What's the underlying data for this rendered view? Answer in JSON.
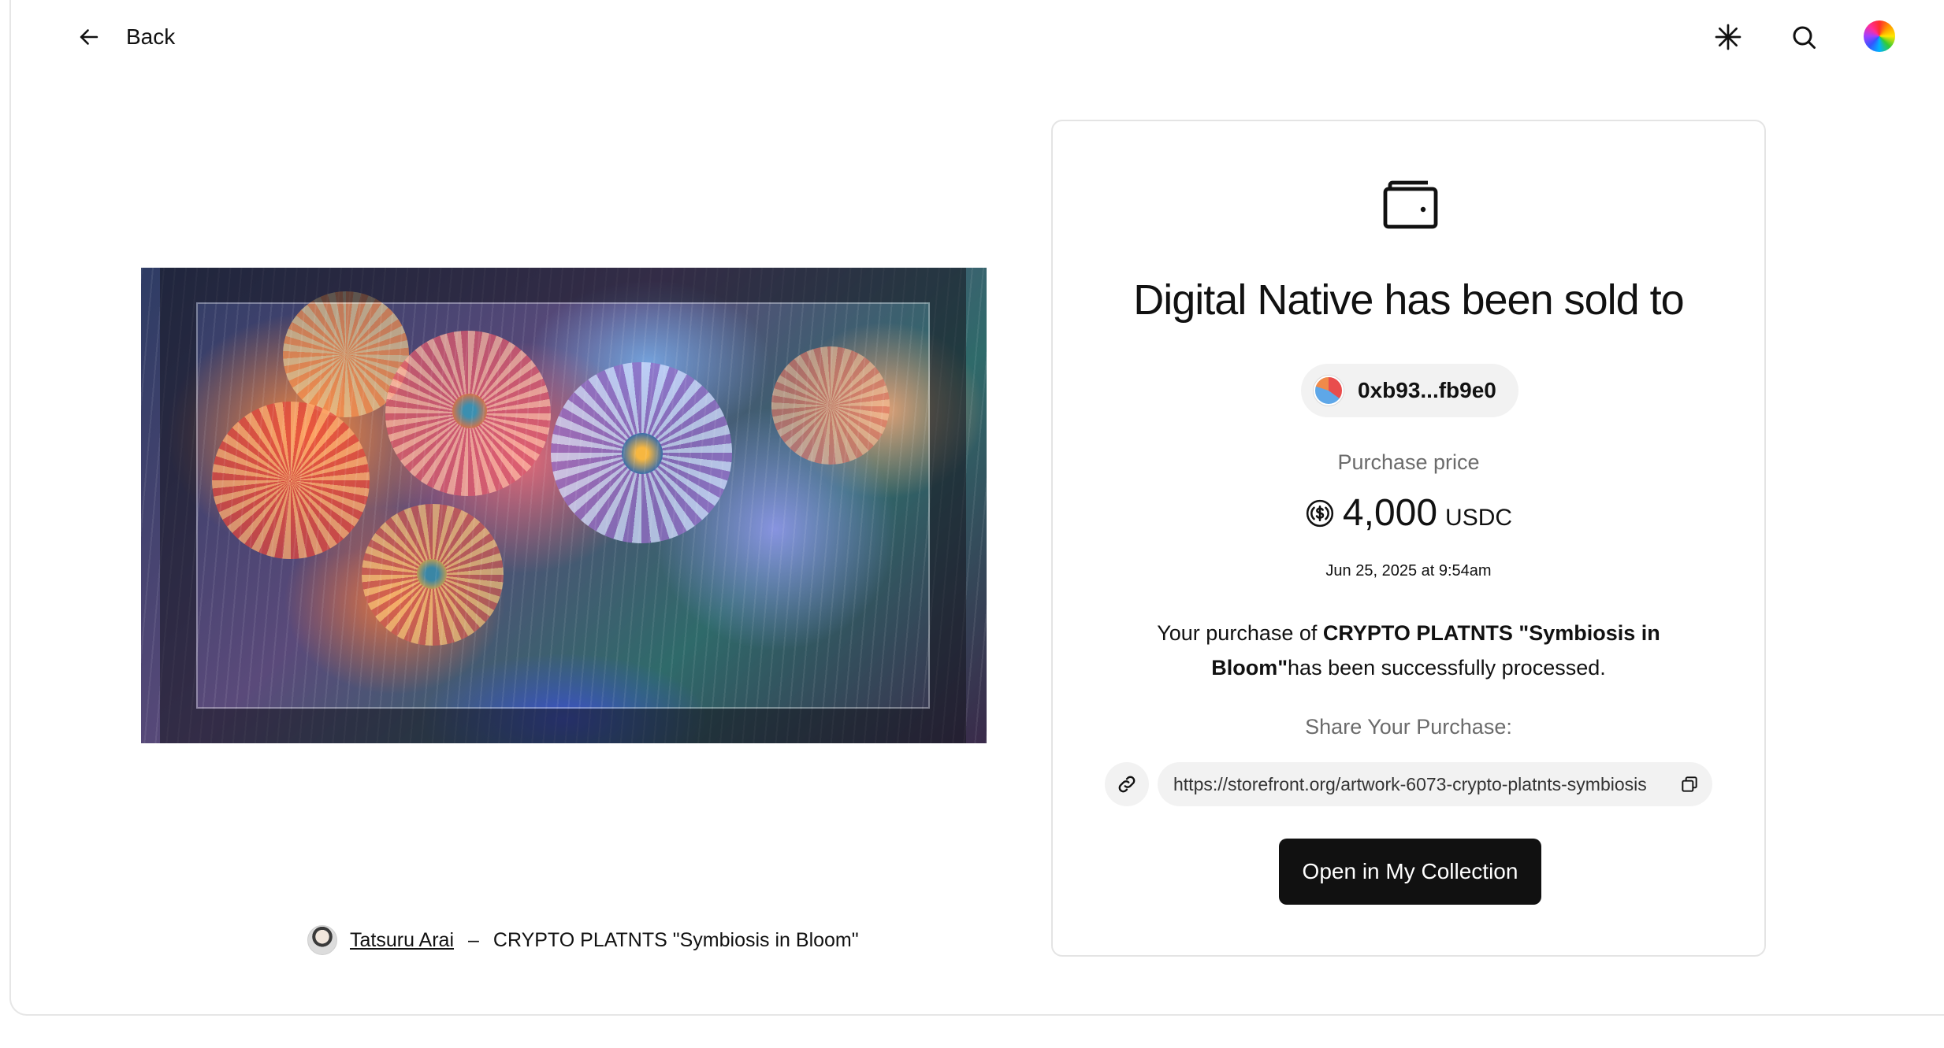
{
  "header": {
    "back_label": "Back",
    "icons": [
      "arrow-left-icon",
      "sparkle-icon",
      "search-icon",
      "profile-avatar"
    ]
  },
  "artwork": {
    "artist": "Tatsuru Arai",
    "separator": "–",
    "title": "CRYPTO PLATNTS \"Symbiosis in Bloom\""
  },
  "sale": {
    "icon": "wallet-icon",
    "heading": "Digital Native has been sold to",
    "buyer_address": "0xb93...fb9e0",
    "price_label": "Purchase price",
    "price_amount": "4,000",
    "price_unit": "USDC",
    "date": "Jun 25, 2025 at 9:54am",
    "message_prefix": "Your purchase of ",
    "message_item": "CRYPTO PLATNTS \"Symbiosis in Bloom\"",
    "message_suffix": "has been successfully processed.",
    "share_label": "Share Your Purchase:",
    "share_url": "https://storefront.org/artwork-6073-crypto-platnts-symbiosis",
    "cta_label": "Open in My Collection"
  },
  "colors": {
    "primary_button": "#111111",
    "muted_text": "#6b6b6b",
    "pill_bg": "#f2f2f2",
    "card_border": "#e4e4e4"
  }
}
